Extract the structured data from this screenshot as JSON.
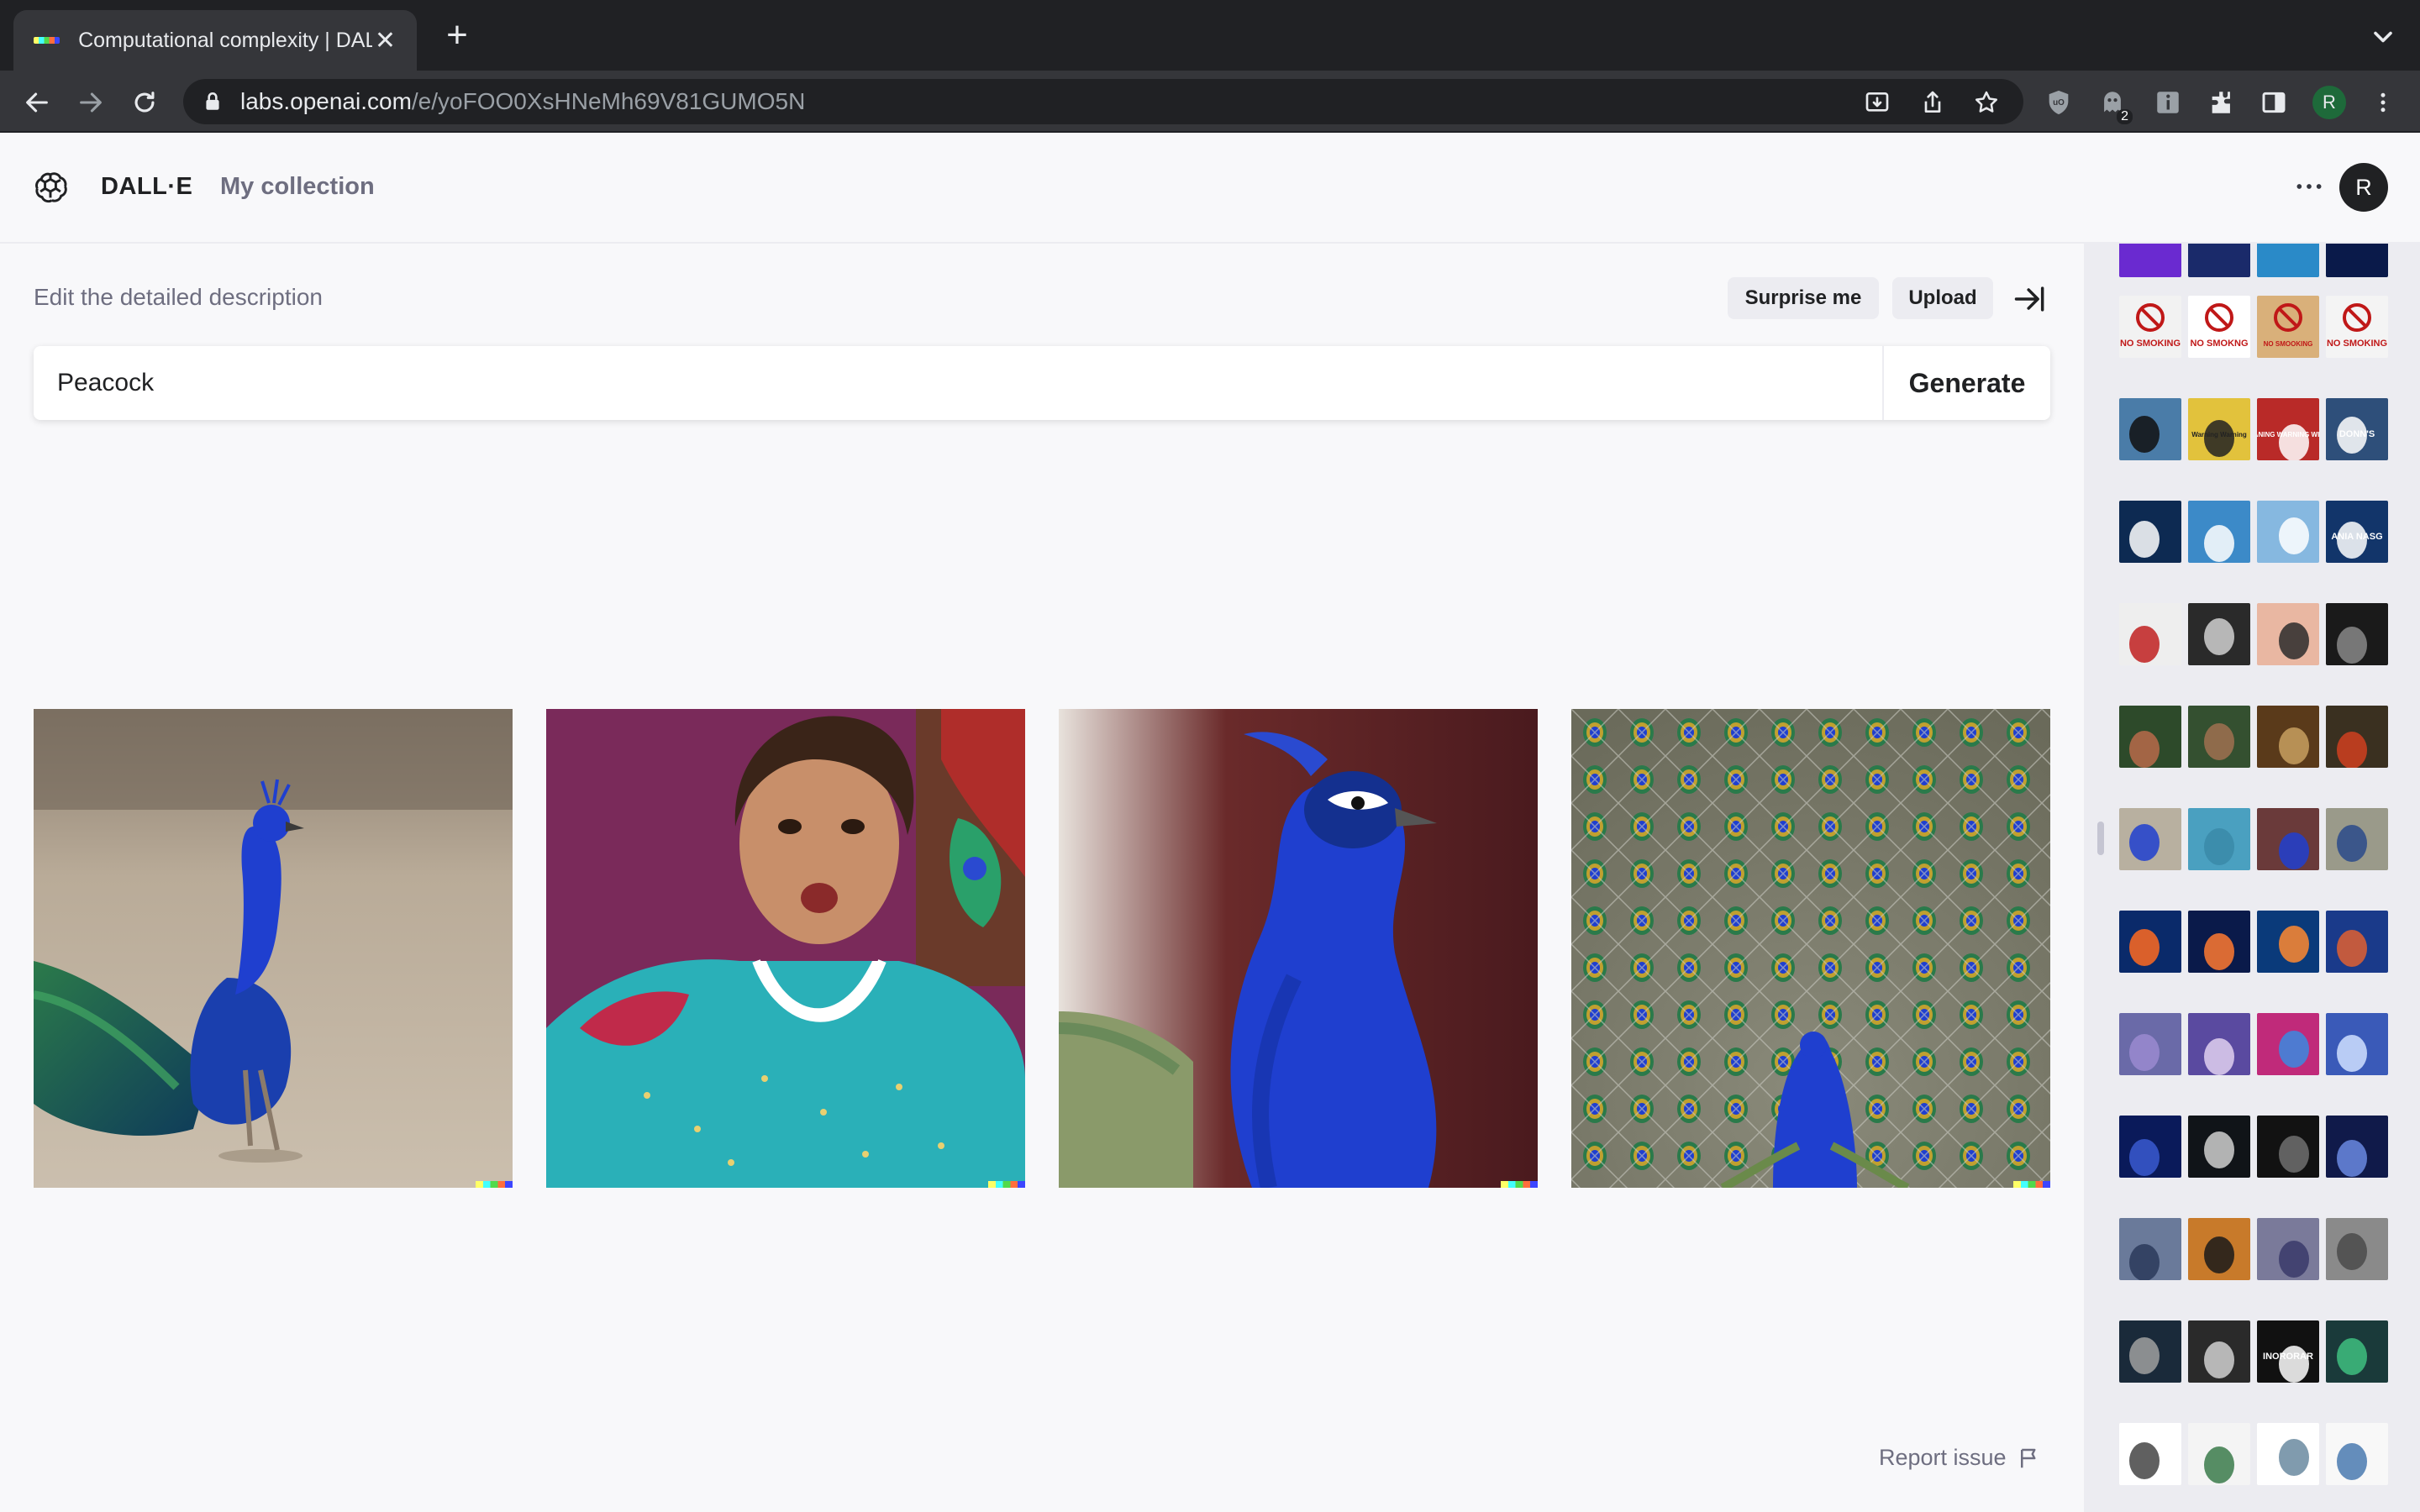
{
  "browser": {
    "tab_title": "Computational complexity | DALL·E",
    "tab_close": "✕",
    "new_tab": "+",
    "url_host": "labs.openai.com",
    "url_path": "/e/yoFOO0XsHNeMh69V81GUMO5N",
    "profile_initial": "R",
    "extension_badge": "2"
  },
  "app": {
    "brand": "DALL·E",
    "my_collection": "My collection",
    "avatar_initial": "R"
  },
  "editor": {
    "description_hint": "Edit the detailed description",
    "surprise_label": "Surprise me",
    "upload_label": "Upload",
    "prompt_value": "Peacock",
    "generate_label": "Generate"
  },
  "results": [
    {
      "subject": "peacock-standing"
    },
    {
      "subject": "girl-teal-shirt"
    },
    {
      "subject": "peacock-closeup"
    },
    {
      "subject": "peacock-fan"
    }
  ],
  "history_rows": [
    {
      "theme": "no-smoking-signs",
      "labels": [
        "NO SMOKING",
        "NO SMOKNG",
        "NO SMOOKING",
        "NO SMOKING"
      ],
      "bg": [
        "#f2f2f2",
        "#ffffff",
        "#d9b07a",
        "#f4f4f4"
      ],
      "fg": [
        "#c01818",
        "#c01818",
        "#c01818",
        "#c01818"
      ]
    },
    {
      "theme": "warning-signs",
      "labels": [
        "",
        "Warning Warning",
        "WANING WARNING WIRE",
        "DONN'S"
      ],
      "bg": [
        "#4a7ca8",
        "#e2c23c",
        "#b92a28",
        "#2e4f7a"
      ],
      "fg": [
        "#111111",
        "#222222",
        "#ffffff",
        "#ffffff"
      ]
    },
    {
      "theme": "blue-graphics",
      "labels": [
        "",
        "",
        "",
        "ANIA NASG"
      ],
      "bg": [
        "#0d2a52",
        "#3c8ac8",
        "#86b8e0",
        "#12356a"
      ],
      "fg": [
        "#ffffff",
        "#ffffff",
        "#ffffff",
        "#ffffff"
      ]
    },
    {
      "theme": "performers",
      "labels": [
        "",
        "",
        "",
        ""
      ],
      "bg": [
        "#eeeeee",
        "#2a2a2a",
        "#e9b7a2",
        "#1a1a1a"
      ],
      "fg": [
        "#c02020",
        "#d0d0d0",
        "#2b2b2b",
        "#888888"
      ]
    },
    {
      "theme": "jungle-roosters",
      "labels": [
        "",
        "",
        "",
        ""
      ],
      "bg": [
        "#2d4a2a",
        "#345030",
        "#5a3a1a",
        "#3a3020"
      ],
      "fg": [
        "#b86a4a",
        "#a07050",
        "#c8a060",
        "#d04020"
      ]
    },
    {
      "theme": "peacocks",
      "labels": [
        "",
        "",
        "",
        ""
      ],
      "bg": [
        "#b8b0a0",
        "#4aa0c0",
        "#6a3a3a",
        "#9a9a8a"
      ],
      "fg": [
        "#1f3fcf",
        "#3a8aa8",
        "#2040d0",
        "#2a4a8a"
      ]
    },
    {
      "theme": "goldfish-bowls",
      "labels": [
        "",
        "",
        "",
        ""
      ],
      "bg": [
        "#0a2a6a",
        "#0a1a4a",
        "#0a3a7a",
        "#1a3a8a"
      ],
      "fg": [
        "#ff6a20",
        "#ff7a30",
        "#ff8a30",
        "#e06030"
      ]
    },
    {
      "theme": "cat-ufos",
      "labels": [
        "",
        "",
        "",
        ""
      ],
      "bg": [
        "#6a6aa8",
        "#5a4aa0",
        "#c02a7a",
        "#3a5ab8"
      ],
      "fg": [
        "#9a8ad0",
        "#e0d0f0",
        "#3a8ae0",
        "#d0e0ff"
      ]
    },
    {
      "theme": "abstract-dark",
      "labels": [
        "",
        "",
        "",
        ""
      ],
      "bg": [
        "#0a1a5a",
        "#101418",
        "#121212",
        "#101a4a"
      ],
      "fg": [
        "#3a5ad0",
        "#cfcfcf",
        "#707070",
        "#6a8ae0"
      ]
    },
    {
      "theme": "sunsets",
      "labels": [
        "",
        "",
        "",
        ""
      ],
      "bg": [
        "#6a7a9a",
        "#c87a2a",
        "#7a7a9a",
        "#8a8a8a"
      ],
      "fg": [
        "#2a3a5a",
        "#1a1a1a",
        "#3a3a6a",
        "#4a4a4a"
      ]
    },
    {
      "theme": "hooded-figures",
      "labels": [
        "",
        "",
        "INORORAR",
        ""
      ],
      "bg": [
        "#1a2a3a",
        "#2a2a2a",
        "#111111",
        "#1a3a3a"
      ],
      "fg": [
        "#a0a0a0",
        "#d0d0d0",
        "#ffffff",
        "#40c080"
      ]
    },
    {
      "theme": "isometric-buildings",
      "labels": [
        "",
        "",
        "",
        ""
      ],
      "bg": [
        "#ffffff",
        "#f4f4f4",
        "#ffffff",
        "#f8f8f8"
      ],
      "fg": [
        "#444444",
        "#3a7a4a",
        "#6a8aa0",
        "#4a7ab0"
      ]
    }
  ],
  "report_issue": "Report issue",
  "colors": {
    "chrome_dark": "#202124",
    "chrome_toolbar": "#35363a",
    "app_bg": "#f8f8fa",
    "sidebar_bg": "#ececf1",
    "muted_text": "#6e6e80",
    "peacock_blue": "#1f3fcf"
  }
}
